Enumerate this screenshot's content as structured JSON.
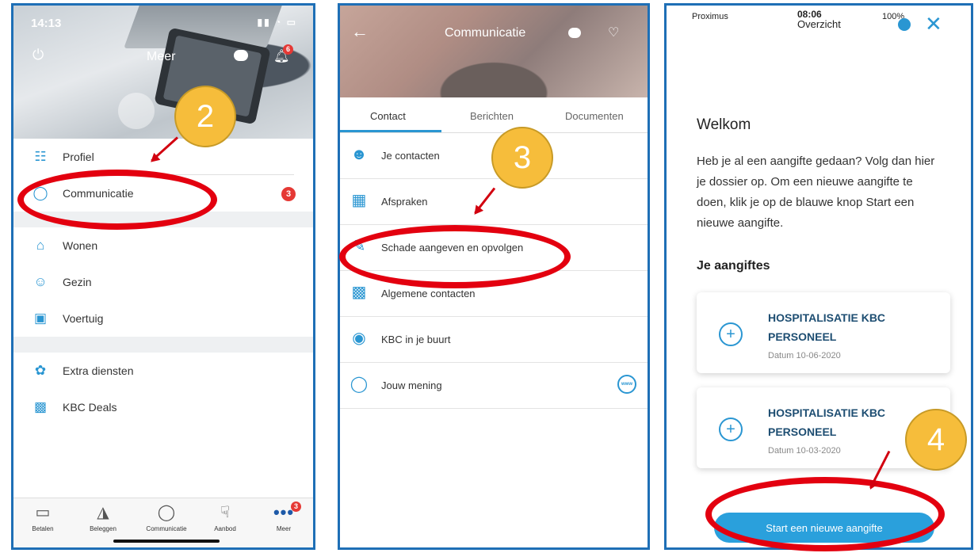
{
  "phone1": {
    "status": {
      "time": "14:13",
      "signal": "▮▮ ◔ ▭"
    },
    "header": {
      "title": "Meer",
      "bell_count": "6"
    },
    "menu": [
      {
        "label": "Profiel",
        "icon": "profile-list-icon"
      },
      {
        "label": "Communicatie",
        "icon": "speech-bubble-icon",
        "count": "3"
      },
      {
        "label": "Wonen",
        "icon": "house-icon"
      },
      {
        "label": "Gezin",
        "icon": "family-icon"
      },
      {
        "label": "Voertuig",
        "icon": "car-icon"
      },
      {
        "label": "Extra diensten",
        "icon": "extra-services-icon"
      },
      {
        "label": "KBC Deals",
        "icon": "coupon-icon"
      }
    ],
    "tabbar": [
      {
        "label": "Betalen",
        "icon": "wallet-icon"
      },
      {
        "label": "Beleggen",
        "icon": "piggy-bank-icon"
      },
      {
        "label": "Communicatie",
        "icon": "speech-bubble-icon"
      },
      {
        "label": "Aanbod",
        "icon": "cart-icon"
      },
      {
        "label": "Meer",
        "icon": "more-dots-icon",
        "badge": "3"
      }
    ]
  },
  "phone2": {
    "header": {
      "title": "Communicatie"
    },
    "tabs": [
      "Contact",
      "Berichten",
      "Documenten"
    ],
    "list": [
      {
        "label": "Je contacten",
        "icon": "person-icon"
      },
      {
        "label": "Afspraken",
        "icon": "calendar-icon"
      },
      {
        "label": "Schade aangeven en opvolgen",
        "icon": "pencil-icon"
      },
      {
        "label": "Algemene contacten",
        "icon": "contact-card-icon"
      },
      {
        "label": "KBC in je buurt",
        "icon": "map-pin-icon"
      },
      {
        "label": "Jouw mening",
        "icon": "speech-bubble-icon",
        "trailing_icon": "globe-icon",
        "trailing_text": "www"
      }
    ]
  },
  "phone3": {
    "status": {
      "carrier": "Proximus",
      "time": "08:06",
      "title": "Overzicht",
      "battery": "100%"
    },
    "title": "Welkom",
    "paragraph": "Heb je al een aangifte gedaan? Volg dan hier je dossier op. Om een nieuwe aangifte te doen, klik je op de blauwe knop Start een nieuwe aangifte.",
    "section_title": "Je aangiftes",
    "claims": [
      {
        "title": "HOSPITALISATIE KBC PERSONEEL",
        "date": "Datum 10-06-2020"
      },
      {
        "title": "HOSPITALISATIE KBC PERSONEEL",
        "date": "Datum 10-03-2020"
      }
    ],
    "start_button": "Start een nieuwe aangifte"
  },
  "annotations": {
    "step2": "2",
    "step3": "3",
    "step4": "4"
  },
  "colors": {
    "frame": "#1e6fb6",
    "accent": "#2a96d2",
    "highlight": "#e3000f",
    "step_badge": "#f6bd3b"
  }
}
